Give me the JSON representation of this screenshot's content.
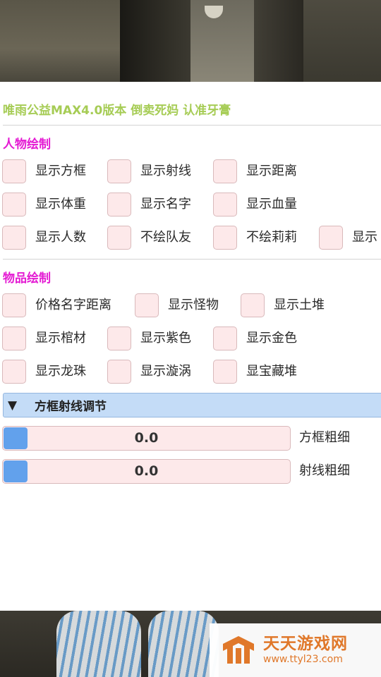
{
  "panel": {
    "title": "唯雨公益MAX4.0版本 倒卖死妈 认准牙膏"
  },
  "character_section": {
    "heading": "人物绘制",
    "options": [
      {
        "label": "显示方框",
        "checked": false
      },
      {
        "label": "显示射线",
        "checked": false
      },
      {
        "label": "显示距离",
        "checked": false
      },
      {
        "label": "显示体重",
        "checked": false
      },
      {
        "label": "显示名字",
        "checked": false
      },
      {
        "label": "显示血量",
        "checked": false
      },
      {
        "label": "显示人数",
        "checked": false
      },
      {
        "label": "不绘队友",
        "checked": false
      },
      {
        "label": "不绘莉莉",
        "checked": false
      },
      {
        "label": "显示",
        "checked": false
      }
    ]
  },
  "item_section": {
    "heading": "物品绘制",
    "options": [
      {
        "label": "价格名字距离",
        "checked": false
      },
      {
        "label": "显示怪物",
        "checked": false
      },
      {
        "label": "显示土堆",
        "checked": false
      },
      {
        "label": "显示棺材",
        "checked": false
      },
      {
        "label": "显示紫色",
        "checked": false
      },
      {
        "label": "显示金色",
        "checked": false
      },
      {
        "label": "显示龙珠",
        "checked": false
      },
      {
        "label": "显示漩涡",
        "checked": false
      },
      {
        "label": "显宝藏堆",
        "checked": false
      }
    ]
  },
  "adjust_section": {
    "arrow": "▼",
    "heading": "方框射线调节",
    "sliders": [
      {
        "value": "0.0",
        "label": "方框粗细",
        "fraction": 0.0
      },
      {
        "value": "0.0",
        "label": "射线粗细",
        "fraction": 0.0
      }
    ]
  },
  "watermark": {
    "title": "天天游戏网",
    "url": "www.ttyl23.com"
  },
  "colors": {
    "title": "#a6cc55",
    "section_heading": "#e41bd3",
    "checkbox_bg": "#fde9ea",
    "slider_fill": "#62a1ec",
    "collapse_bg": "#c4dcf7",
    "watermark": "#e0782a"
  }
}
